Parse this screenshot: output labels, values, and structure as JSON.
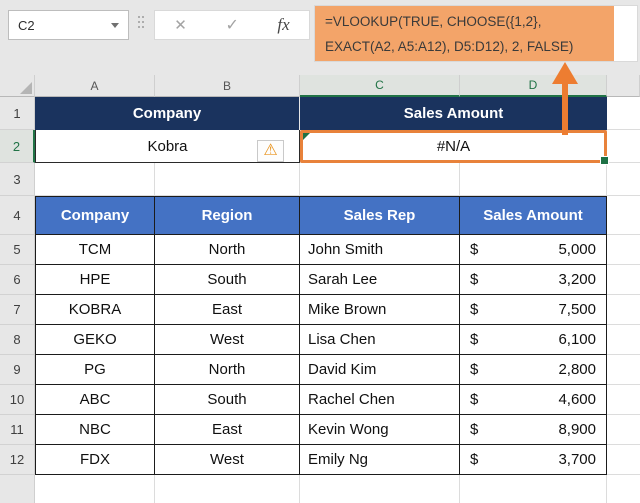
{
  "name_box": {
    "value": "C2"
  },
  "formula_tools": {
    "cancel_icon": "✕",
    "enter_icon": "✓",
    "fx_icon": "fx"
  },
  "formula_bar": {
    "line1": "=VLOOKUP(TRUE, CHOOSE({1,2},",
    "line2": "EXACT(A2, A5:A12), D5:D12), 2, FALSE)"
  },
  "colors": {
    "accent_orange": "#ED7D31",
    "highlight_orange": "#F3A469",
    "navy_header": "#1A335E",
    "table_header_blue": "#4472C4",
    "selection_green": "#217346"
  },
  "sheet": {
    "column_headers": [
      "A",
      "B",
      "C",
      "D"
    ],
    "row_headers": [
      "1",
      "2",
      "3",
      "4",
      "5",
      "6",
      "7",
      "8",
      "9",
      "10",
      "11",
      "12"
    ],
    "selected_cell_range": {
      "columns": [
        "C",
        "D"
      ],
      "row": "2"
    },
    "lookup_block": {
      "company_header": "Company",
      "sales_header": "Sales Amount",
      "company_value": "Kobra",
      "result_value": "#N/A"
    },
    "warning_icon": "⚠",
    "data_table": {
      "headers": [
        "Company",
        "Region",
        "Sales Rep",
        "Sales Amount"
      ],
      "rows": [
        {
          "company": "TCM",
          "region": "North",
          "sales_rep": "John Smith",
          "currency": "$",
          "amount": "5,000"
        },
        {
          "company": "HPE",
          "region": "South",
          "sales_rep": "Sarah Lee",
          "currency": "$",
          "amount": "3,200"
        },
        {
          "company": "KOBRA",
          "region": "East",
          "sales_rep": "Mike Brown",
          "currency": "$",
          "amount": "7,500"
        },
        {
          "company": "GEKO",
          "region": "West",
          "sales_rep": "Lisa Chen",
          "currency": "$",
          "amount": "6,100"
        },
        {
          "company": "PG",
          "region": "North",
          "sales_rep": "David Kim",
          "currency": "$",
          "amount": "2,800"
        },
        {
          "company": "ABC",
          "region": "South",
          "sales_rep": "Rachel Chen",
          "currency": "$",
          "amount": "4,600"
        },
        {
          "company": "NBC",
          "region": "East",
          "sales_rep": "Kevin Wong",
          "currency": "$",
          "amount": "8,900"
        },
        {
          "company": "FDX",
          "region": "West",
          "sales_rep": "Emily Ng",
          "currency": "$",
          "amount": "3,700"
        }
      ]
    }
  }
}
